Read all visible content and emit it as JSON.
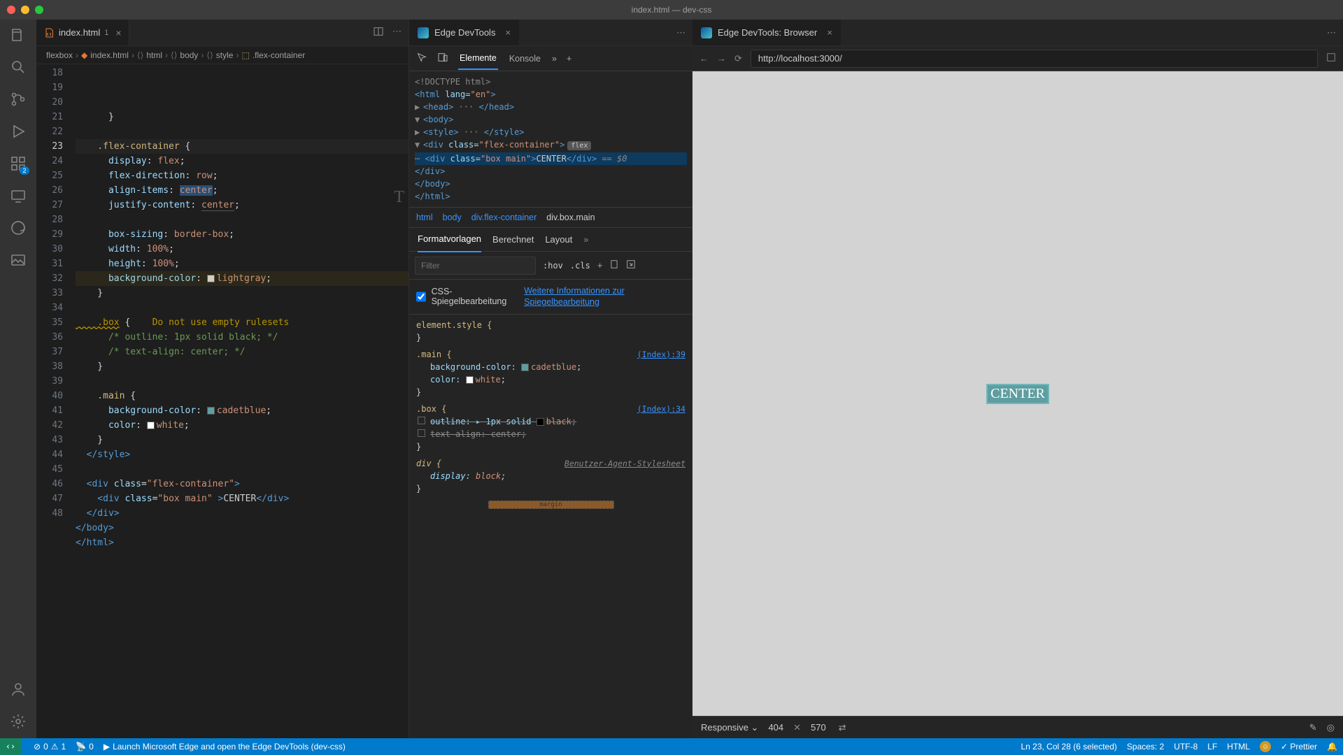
{
  "window_title": "index.html — dev-css",
  "activity_badge": "2",
  "editor": {
    "tab": {
      "name": "index.html",
      "dirty": "1"
    },
    "breadcrumb": [
      "flexbox",
      "index.html",
      "html",
      "body",
      "style",
      ".flex-container"
    ],
    "lines_start": 18,
    "cursor_line": 23,
    "warn_line": 32,
    "minimap_char": "T"
  },
  "devtools": {
    "tab_title": "Edge DevTools",
    "toolbar": {
      "elements": "Elemente",
      "console": "Konsole"
    },
    "dom": {
      "doctype": "<!DOCTYPE html>",
      "html_open": "<html lang=\"en\">",
      "head": "<head> ··· </head>",
      "body": "<body>",
      "style": "<style> ··· </style>",
      "div_flex": "<div class=\"flex-container\">",
      "flex_badge": "flex",
      "div_box": "<div class=\"box main\">CENTER</div>",
      "eq0": "== $0",
      "div_close": "</div>",
      "body_close": "</body>",
      "html_close": "</html>"
    },
    "crumbs": [
      "html",
      "body",
      "div.flex-container",
      "div.box.main"
    ],
    "styles_tabs": {
      "styles": "Formatvorlagen",
      "computed": "Berechnet",
      "layout": "Layout"
    },
    "filter_placeholder": "Filter",
    "hov": ":hov",
    "cls": ".cls",
    "mirror_label": "CSS-Spiegelbearbeitung",
    "mirror_link": "Weitere Informationen zur Spiegelbearbeitung",
    "rules": {
      "element_style": "element.style {",
      "main_sel": ".main {",
      "main_src": "(Index):39",
      "main_bg": "background-color:",
      "main_bg_val": "cadetblue",
      "main_color": "color:",
      "main_color_val": "white",
      "box_sel": ".box {",
      "box_src": "(Index):34",
      "box_outline": "outline: ▸ 1px solid",
      "box_outline_val": "black",
      "box_ta": "text-align: center;",
      "div_sel": "div {",
      "ua_label": "Benutzer-Agent-Stylesheet",
      "div_display": "display: block;"
    },
    "boxmodel_label": "margin"
  },
  "browser": {
    "tab_title": "Edge DevTools: Browser",
    "url": "http://localhost:3000/",
    "center_text": "CENTER",
    "footer": {
      "mode": "Responsive",
      "width": "404",
      "height": "570"
    }
  },
  "status": {
    "errors": "0",
    "warnings": "1",
    "ports": "0",
    "launch_msg": "Launch Microsoft Edge and open the Edge DevTools (dev-css)",
    "cursor": "Ln 23, Col 28 (6 selected)",
    "spaces": "Spaces: 2",
    "encoding": "UTF-8",
    "eol": "LF",
    "lang": "HTML",
    "prettier": "Prettier"
  }
}
